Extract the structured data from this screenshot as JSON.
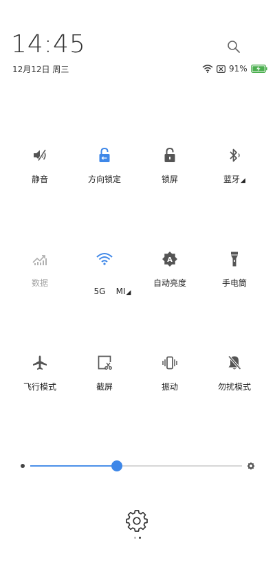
{
  "header": {
    "time": "14:45",
    "date": "12月12日 周三",
    "battery_percent": "91%"
  },
  "tiles": [
    {
      "label": "静音",
      "icon": "mute-icon",
      "active": false
    },
    {
      "label": "方向锁定",
      "icon": "rotation-lock-icon",
      "active": true
    },
    {
      "label": "锁屏",
      "icon": "lock-screen-icon",
      "active": false
    },
    {
      "label": "蓝牙",
      "icon": "bluetooth-icon",
      "active": false,
      "has_dropdown": true
    },
    {
      "label": "数据",
      "icon": "mobile-data-icon",
      "active": false,
      "disabled": true
    },
    {
      "label": "5G    MI",
      "icon": "wifi-icon",
      "active": true,
      "has_dropdown": true
    },
    {
      "label": "自动亮度",
      "icon": "auto-brightness-icon",
      "active": false
    },
    {
      "label": "手电筒",
      "icon": "flashlight-icon",
      "active": false
    },
    {
      "label": "飞行模式",
      "icon": "airplane-mode-icon",
      "active": false
    },
    {
      "label": "截屏",
      "icon": "screenshot-icon",
      "active": false
    },
    {
      "label": "振动",
      "icon": "vibrate-icon",
      "active": false
    },
    {
      "label": "勿扰模式",
      "icon": "do-not-disturb-icon",
      "active": false
    }
  ],
  "brightness": {
    "level": 0.41
  },
  "pager": {
    "pages": 2,
    "current": 1
  },
  "colors": {
    "accent": "#3e87e8",
    "icon": "#555555",
    "disabled": "#b0b0b0"
  }
}
